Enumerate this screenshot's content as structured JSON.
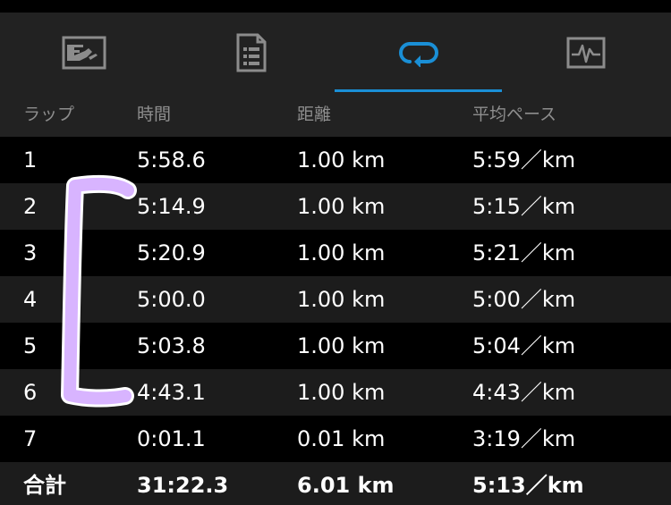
{
  "tabs": [
    {
      "icon": "map-icon",
      "active": false
    },
    {
      "icon": "summary-list-icon",
      "active": false
    },
    {
      "icon": "laps-loop-icon",
      "active": true
    },
    {
      "icon": "graph-icon",
      "active": false
    }
  ],
  "colors": {
    "accent": "#1a8fd6",
    "icon_inactive": "#8c8c8c",
    "annotation": "#d8b4ff"
  },
  "table": {
    "headers": {
      "lap": "ラップ",
      "time": "時間",
      "distance": "距離",
      "pace": "平均ペース"
    },
    "rows": [
      {
        "lap": "1",
        "time": "5:58.6",
        "distance": "1.00 km",
        "pace": "5:59／km"
      },
      {
        "lap": "2",
        "time": "5:14.9",
        "distance": "1.00 km",
        "pace": "5:15／km"
      },
      {
        "lap": "3",
        "time": "5:20.9",
        "distance": "1.00 km",
        "pace": "5:21／km"
      },
      {
        "lap": "4",
        "time": "5:00.0",
        "distance": "1.00 km",
        "pace": "5:00／km"
      },
      {
        "lap": "5",
        "time": "5:03.8",
        "distance": "1.00 km",
        "pace": "5:04／km"
      },
      {
        "lap": "6",
        "time": "4:43.1",
        "distance": "1.00 km",
        "pace": "4:43／km"
      },
      {
        "lap": "7",
        "time": "0:01.1",
        "distance": "0.01 km",
        "pace": "3:19／km"
      }
    ],
    "total": {
      "lap": "合計",
      "time": "31:22.3",
      "distance": "6.01 km",
      "pace": "5:13／km"
    }
  }
}
